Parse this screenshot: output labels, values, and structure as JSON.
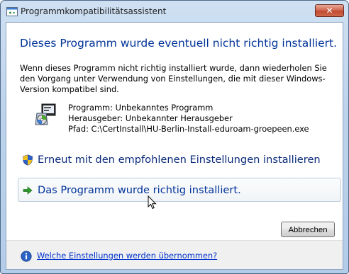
{
  "window": {
    "title": "Programmkompatibilitätsassistent",
    "close_glyph": "✕"
  },
  "content": {
    "headline": "Dieses Programm wurde eventuell nicht richtig installiert.",
    "description": "Wenn dieses Programm nicht richtig installiert wurde, dann wiederholen Sie den Vorgang unter Verwendung von Einstellungen, die mit dieser Windows-Version kompatibel sind.",
    "program": {
      "icon": "installer-icon",
      "name_line": "Programm: Unbekanntes Programm",
      "publisher_line": "Herausgeber: Unbekannter Herausgeber",
      "path_line": "Pfad: C:\\CertInstall\\HU-Berlin-Install-eduroam-groepeen.exe"
    }
  },
  "options": {
    "reinstall_recommended": {
      "icon": "shield-icon",
      "label": "Erneut mit den empfohlenen Einstellungen installieren"
    },
    "installed_correctly": {
      "icon": "green-arrow-icon",
      "label": "Das Programm wurde richtig installiert."
    }
  },
  "buttons": {
    "cancel_label": "Abbrechen"
  },
  "footer": {
    "icon": "info-icon",
    "link_text": "Welche Einstellungen werden übernommen?"
  },
  "colors": {
    "headline": "#003399",
    "link": "#0033cc",
    "close_button": "#c04a32"
  }
}
